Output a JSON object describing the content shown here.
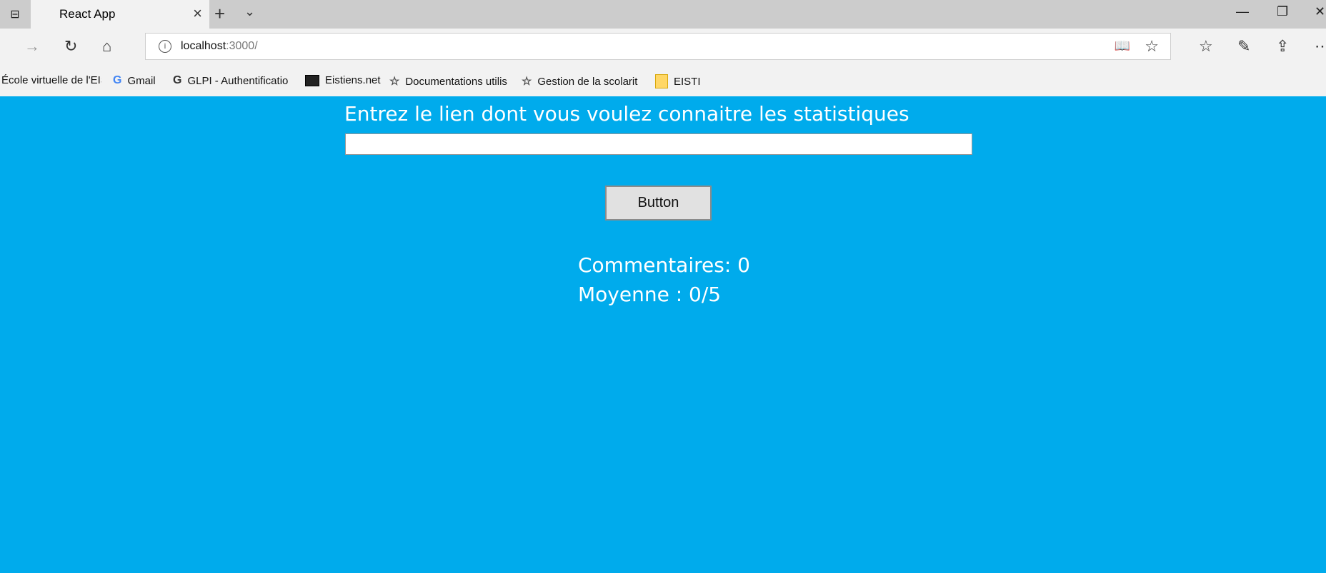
{
  "browser": {
    "tab_title": "React App",
    "url_host": "localhost",
    "url_path": ":3000/"
  },
  "bookmarks": [
    "École virtuelle de l'EIS",
    "Gmail",
    "GLPI - Authentificatio",
    "Eistiens.net",
    "Documentations utilis",
    "Gestion de la scolarit",
    "EISTI"
  ],
  "main": {
    "prompt": "Entrez le lien dont vous voulez connaitre les statistiques",
    "input_value": "",
    "button_label": "Button",
    "comments_text": "Commentaires: 0",
    "average_text": "Moyenne : 0/5"
  },
  "colors": {
    "page_bg": "#00abec",
    "text": "#ffffff"
  }
}
